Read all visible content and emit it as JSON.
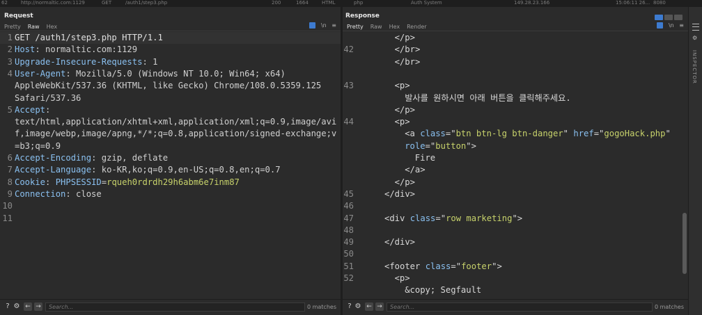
{
  "history_row": [
    "http://normaltic.com:1129",
    "GET",
    "/auth1/step3.php",
    "200",
    "1664",
    "HTML",
    "php",
    "Auth System",
    "149.28.23.166",
    "15:06:11 26...",
    "8080"
  ],
  "request": {
    "title": "Request",
    "tabs": [
      "Pretty",
      "Raw",
      "Hex"
    ],
    "active_tab": "Raw",
    "lines": [
      {
        "n": "1",
        "parts": [
          {
            "t": "GET /auth1/step3.php HTTP/1.1",
            "c": "plain"
          }
        ]
      },
      {
        "n": "2",
        "parts": [
          {
            "t": "Host",
            "c": "key"
          },
          {
            "t": ": normaltic.com:1129",
            "c": "val"
          }
        ]
      },
      {
        "n": "3",
        "parts": [
          {
            "t": "Upgrade-Insecure-Requests",
            "c": "key"
          },
          {
            "t": ": 1",
            "c": "val"
          }
        ]
      },
      {
        "n": "4",
        "parts": [
          {
            "t": "User-Agent",
            "c": "key"
          },
          {
            "t": ": Mozilla/5.0 (Windows NT 10.0; Win64; x64)",
            "c": "val"
          }
        ]
      },
      {
        "n": "",
        "parts": [
          {
            "t": "AppleWebKit/537.36 (KHTML, like Gecko) Chrome/108.0.5359.125",
            "c": "val"
          }
        ]
      },
      {
        "n": "",
        "parts": [
          {
            "t": "Safari/537.36",
            "c": "val"
          }
        ]
      },
      {
        "n": "5",
        "parts": [
          {
            "t": "Accept",
            "c": "key"
          },
          {
            "t": ":",
            "c": "val"
          }
        ]
      },
      {
        "n": "",
        "parts": [
          {
            "t": "text/html,application/xhtml+xml,application/xml;q=0.9,image/avi",
            "c": "val"
          }
        ]
      },
      {
        "n": "",
        "parts": [
          {
            "t": "f,image/webp,image/apng,*/*;q=0.8,application/signed-exchange;v",
            "c": "val"
          }
        ]
      },
      {
        "n": "",
        "parts": [
          {
            "t": "=b3;q=0.9",
            "c": "val"
          }
        ]
      },
      {
        "n": "6",
        "parts": [
          {
            "t": "Accept-Encoding",
            "c": "key"
          },
          {
            "t": ": gzip, deflate",
            "c": "val"
          }
        ]
      },
      {
        "n": "7",
        "parts": [
          {
            "t": "Accept-Language",
            "c": "key"
          },
          {
            "t": ": ko-KR,ko;q=0.9,en-US;q=0.8,en;q=0.7",
            "c": "val"
          }
        ]
      },
      {
        "n": "8",
        "parts": [
          {
            "t": "Cookie",
            "c": "key"
          },
          {
            "t": ": ",
            "c": "val"
          },
          {
            "t": "PHPSESSID",
            "c": "key"
          },
          {
            "t": "=",
            "c": "val"
          },
          {
            "t": "rqueh0rdrdh29h6abm6e7inm87",
            "c": "cookieval"
          }
        ]
      },
      {
        "n": "9",
        "parts": [
          {
            "t": "Connection",
            "c": "key"
          },
          {
            "t": ": close",
            "c": "val"
          }
        ]
      },
      {
        "n": "10",
        "parts": []
      },
      {
        "n": "11",
        "parts": []
      }
    ],
    "search_placeholder": "Search...",
    "matches": "0 matches"
  },
  "response": {
    "title": "Response",
    "tabs": [
      "Pretty",
      "Raw",
      "Hex",
      "Render"
    ],
    "active_tab": "Pretty",
    "lines": [
      {
        "n": "",
        "indent": 1,
        "parts": [
          {
            "t": "</p>",
            "c": "tag"
          }
        ]
      },
      {
        "n": "42",
        "indent": 1,
        "parts": [
          {
            "t": "</br>",
            "c": "tag"
          }
        ]
      },
      {
        "n": "",
        "indent": 1,
        "parts": [
          {
            "t": "</br>",
            "c": "tag"
          }
        ]
      },
      {
        "n": "",
        "indent": 0,
        "parts": []
      },
      {
        "n": "43",
        "indent": 1,
        "parts": [
          {
            "t": "<p>",
            "c": "tag"
          }
        ]
      },
      {
        "n": "",
        "indent": 2,
        "parts": [
          {
            "t": "발사를 원하시면 아래 버튼을 클릭해주세요.",
            "c": "tag"
          }
        ]
      },
      {
        "n": "",
        "indent": 1,
        "parts": [
          {
            "t": "</p>",
            "c": "tag"
          }
        ]
      },
      {
        "n": "44",
        "indent": 1,
        "parts": [
          {
            "t": "<p>",
            "c": "tag"
          }
        ]
      },
      {
        "n": "",
        "indent": 2,
        "parts": [
          {
            "t": "<a ",
            "c": "tag"
          },
          {
            "t": "class",
            "c": "attr"
          },
          {
            "t": "=\"",
            "c": "tag"
          },
          {
            "t": "btn btn-lg btn-danger",
            "c": "aval"
          },
          {
            "t": "\" ",
            "c": "tag"
          },
          {
            "t": "href",
            "c": "attr"
          },
          {
            "t": "=\"",
            "c": "tag"
          },
          {
            "t": "gogoHack.php",
            "c": "aval"
          },
          {
            "t": "\"",
            "c": "tag"
          }
        ]
      },
      {
        "n": "",
        "indent": 2,
        "parts": [
          {
            "t": "role",
            "c": "attr"
          },
          {
            "t": "=\"",
            "c": "tag"
          },
          {
            "t": "button",
            "c": "aval"
          },
          {
            "t": "\">",
            "c": "tag"
          }
        ]
      },
      {
        "n": "",
        "indent": 3,
        "parts": [
          {
            "t": "Fire",
            "c": "tag"
          }
        ]
      },
      {
        "n": "",
        "indent": 2,
        "parts": [
          {
            "t": "</a>",
            "c": "tag"
          }
        ]
      },
      {
        "n": "",
        "indent": 1,
        "parts": [
          {
            "t": "</p>",
            "c": "tag"
          }
        ]
      },
      {
        "n": "45",
        "indent": 0,
        "parts": [
          {
            "t": "</div>",
            "c": "tag"
          }
        ]
      },
      {
        "n": "46",
        "indent": 0,
        "parts": []
      },
      {
        "n": "47",
        "indent": 0,
        "parts": [
          {
            "t": "<div ",
            "c": "tag"
          },
          {
            "t": "class",
            "c": "attr"
          },
          {
            "t": "=\"",
            "c": "tag"
          },
          {
            "t": "row marketing",
            "c": "aval"
          },
          {
            "t": "\">",
            "c": "tag"
          }
        ]
      },
      {
        "n": "48",
        "indent": 0,
        "parts": []
      },
      {
        "n": "49",
        "indent": 0,
        "parts": [
          {
            "t": "</div>",
            "c": "tag"
          }
        ]
      },
      {
        "n": "50",
        "indent": 0,
        "parts": []
      },
      {
        "n": "51",
        "indent": 0,
        "parts": [
          {
            "t": "<footer ",
            "c": "tag"
          },
          {
            "t": "class",
            "c": "attr"
          },
          {
            "t": "=\"",
            "c": "tag"
          },
          {
            "t": "footer",
            "c": "aval"
          },
          {
            "t": "\">",
            "c": "tag"
          }
        ]
      },
      {
        "n": "52",
        "indent": 1,
        "parts": [
          {
            "t": "<p>",
            "c": "tag"
          }
        ]
      },
      {
        "n": "",
        "indent": 2,
        "parts": [
          {
            "t": "&copy; Segfault",
            "c": "tag"
          }
        ]
      },
      {
        "n": "",
        "indent": 1,
        "parts": [
          {
            "t": "</p>",
            "c": "tag"
          }
        ]
      }
    ],
    "search_placeholder": "Search...",
    "matches": "0 matches"
  },
  "editor_tools": {
    "wrap": "⇆",
    "newline": "\\n",
    "menu": "≡"
  },
  "footer_icons": {
    "help": "?",
    "settings": "⚙",
    "back": "←",
    "forward": "→"
  },
  "inspector": {
    "label": "INSPECTOR"
  },
  "colors": {
    "accent": "#3d7bd0",
    "tab_underline": "#e8a040",
    "key": "#8ac0f0",
    "value_string": "#c7d26b"
  }
}
